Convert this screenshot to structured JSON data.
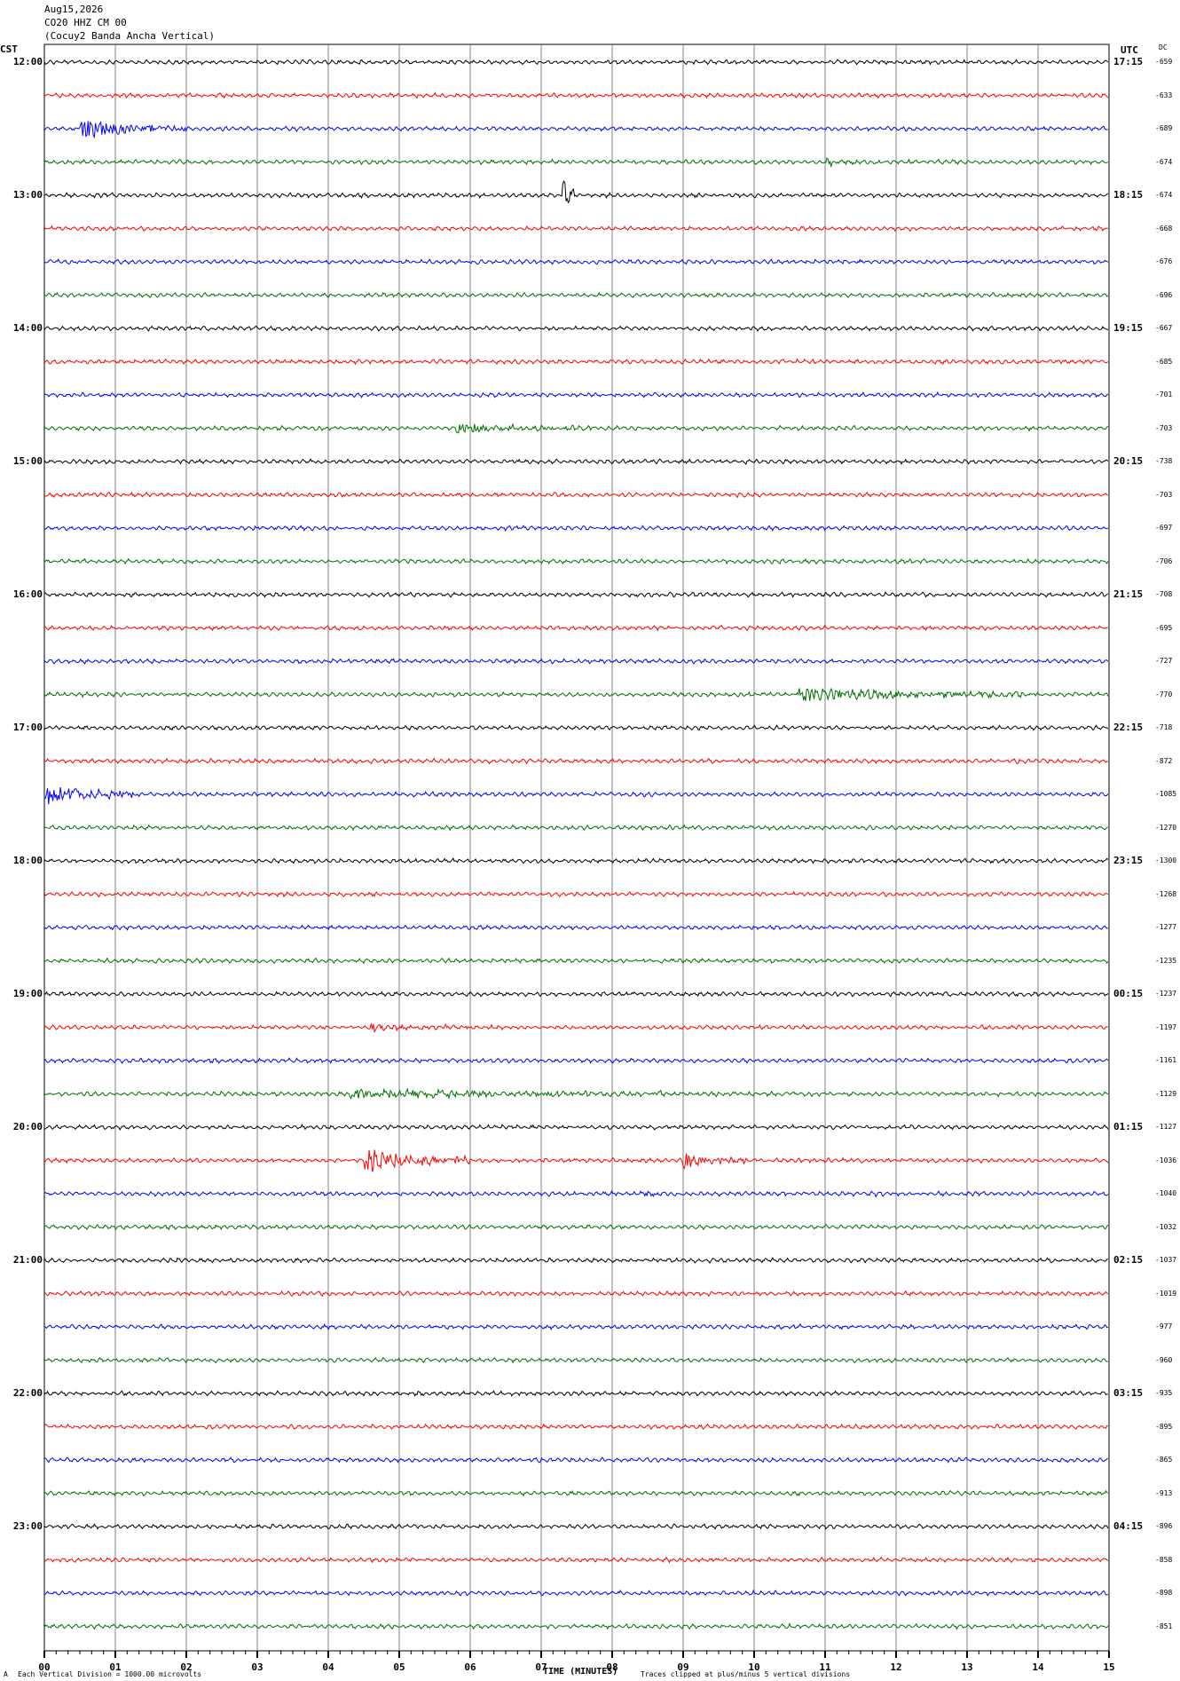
{
  "header": {
    "date": "Aug15,2026",
    "station": "CO20 HHZ CM 00",
    "description": "(Cocuy2 Banda Ancha Vertical)"
  },
  "axes": {
    "left_label": "CST",
    "right_label": "UTC",
    "dc_label": "DC",
    "x_title": "TIME (MINUTES)",
    "footer_left": "Each Vertical Division = 1000.00 microvolts",
    "footer_right": "Traces clipped at plus/minus 5 vertical divisions",
    "corner_mark": "A"
  },
  "colors": {
    "cycle": [
      "#000000",
      "#ff0000",
      "#0000ff",
      "#007000"
    ],
    "grid": "#808080"
  },
  "chart_data": {
    "type": "line",
    "title": "",
    "xlabel": "TIME (MINUTES)",
    "ylabel": "",
    "x_ticks": [
      "00",
      "01",
      "02",
      "03",
      "04",
      "05",
      "06",
      "07",
      "08",
      "09",
      "10",
      "11",
      "12",
      "13",
      "14",
      "15"
    ],
    "xlim": [
      0,
      15
    ],
    "hour_labels_cst": [
      "12:00",
      "13:00",
      "14:00",
      "15:00",
      "16:00",
      "17:00",
      "18:00",
      "19:00",
      "20:00",
      "21:00",
      "22:00",
      "23:00"
    ],
    "hour_labels_utc": [
      "17:15",
      "18:15",
      "19:15",
      "20:15",
      "21:15",
      "22:15",
      "23:15",
      "00:15",
      "01:15",
      "02:15",
      "03:15",
      "04:15"
    ],
    "dc_offsets": [
      "-659",
      "-633",
      "-689",
      "-674",
      "-674",
      "-668",
      "-676",
      "-696",
      "-667",
      "-685",
      "-701",
      "-703",
      "-738",
      "-703",
      "-697",
      "-706",
      "-708",
      "-695",
      "-727",
      "-770",
      "-718",
      "-872",
      "-1085",
      "-1270",
      "-1300",
      "-1268",
      "-1277",
      "-1235",
      "-1237",
      "-1197",
      "-1161",
      "-1129",
      "-1127",
      "-1036",
      "-1040",
      "-1032",
      "-1037",
      "-1019",
      "-977",
      "-960",
      "-935",
      "-895",
      "-865",
      "-913",
      "-896",
      "-858",
      "-898",
      "-851"
    ],
    "events": [
      {
        "trace": 2,
        "start": 0.5,
        "end": 2.0,
        "amp": 2.4
      },
      {
        "trace": 3,
        "start": 11.0,
        "end": 12.0,
        "amp": 0.6
      },
      {
        "trace": 4,
        "start": 7.3,
        "end": 7.5,
        "amp": 4.0
      },
      {
        "trace": 11,
        "start": 5.8,
        "end": 8.0,
        "amp": 1.0
      },
      {
        "trace": 17,
        "start": 8.6,
        "end": 8.7,
        "amp": 1.2
      },
      {
        "trace": 19,
        "start": 10.6,
        "end": 14.0,
        "amp": 1.6
      },
      {
        "trace": 21,
        "start": 2.0,
        "end": 2.05,
        "amp": 1.8
      },
      {
        "trace": 22,
        "start": 0.0,
        "end": 1.3,
        "amp": 2.6
      },
      {
        "trace": 29,
        "start": 4.6,
        "end": 6.5,
        "amp": 0.8
      },
      {
        "trace": 31,
        "start": 4.3,
        "end": 9.5,
        "amp": 1.1
      },
      {
        "trace": 33,
        "start": 4.5,
        "end": 6.0,
        "amp": 2.6
      },
      {
        "trace": 33,
        "start": 9.0,
        "end": 9.9,
        "amp": 1.8
      },
      {
        "trace": 34,
        "start": 8.4,
        "end": 8.9,
        "amp": 0.6
      },
      {
        "trace": 34,
        "start": 11.7,
        "end": 11.8,
        "amp": 0.7
      }
    ]
  }
}
